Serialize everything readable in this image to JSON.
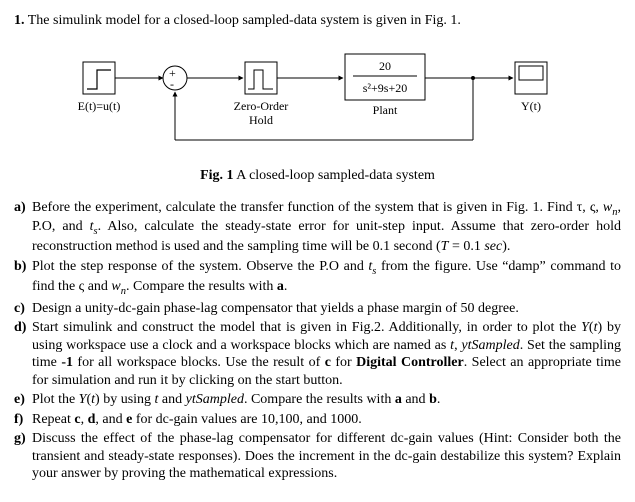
{
  "question": {
    "number": "1.",
    "intro": "The simulink model for a closed-loop sampled-data system is given in Fig. 1."
  },
  "diagram": {
    "input_label": "E(t)=u(t)",
    "zoh_label_1": "Zero-Order",
    "zoh_label_2": "Hold",
    "plant_numerator": "20",
    "plant_denominator": "s²+9s+20",
    "plant_label": "Plant",
    "output_label": "Y(t)"
  },
  "caption": {
    "bold": "Fig. 1",
    "rest": " A closed-loop sampled-data system"
  },
  "parts": {
    "a": {
      "label": "a)",
      "html": "Before the experiment, calculate the transfer function of the system that is given in Fig. 1. Find τ, ς, <span class='math'>w<span class='sub'>n</span></span>, P.O, and <span class='math'>t<span class='sub'>s</span></span>. Also, calculate the steady-state error for unit-step input. Assume that zero-order hold reconstruction method is used and the sampling time will be 0.1 second (<span class='math'>T</span> = 0.1 <span class='math'>sec</span>)."
    },
    "b": {
      "label": "b)",
      "html": "Plot the step response of the system. Observe the P.O and <span class='math'>t<span class='sub'>s</span></span> from the figure. Use “damp” command to find the ς and <span class='math'>w<span class='sub'>n</span></span>. Compare the results with <b>a</b>."
    },
    "c": {
      "label": "c)",
      "html": "Design a unity-dc-gain phase-lag compensator that yields a phase margin of 50 degree."
    },
    "d": {
      "label": "d)",
      "html": "Start simulink and construct the model that is given in Fig.2. Additionally, in order to plot the <span class='math'>Y</span>(<span class='math'>t</span>) by using workspace use a clock and a workspace blocks which are named as <span class='math'>t</span>, <span class='math'>ytSampled</span>. Set the sampling time <b>-1</b> for all workspace blocks. Use the result of <b>c</b> for <b>Digital Controller</b>. Select an appropriate time for simulation and run it by clicking on the start button."
    },
    "e": {
      "label": "e)",
      "html": "Plot the <span class='math'>Y</span>(<span class='math'>t</span>) by using <span class='math'>t</span> and <span class='math'>ytSampled</span>. Compare the results with <b>a</b> and <b>b</b>."
    },
    "f": {
      "label": "f)",
      "html": "Repeat <b>c</b>, <b>d</b>, and <b>e</b> for dc-gain values are 10,100, and 1000."
    },
    "g": {
      "label": "g)",
      "html": "Discuss the effect of the phase-lag compensator for different dc-gain values (Hint: Consider both the transient and steady-state responses). Does the increment in the dc-gain destabilize this system? Explain your answer by proving the mathematical expressions."
    }
  }
}
